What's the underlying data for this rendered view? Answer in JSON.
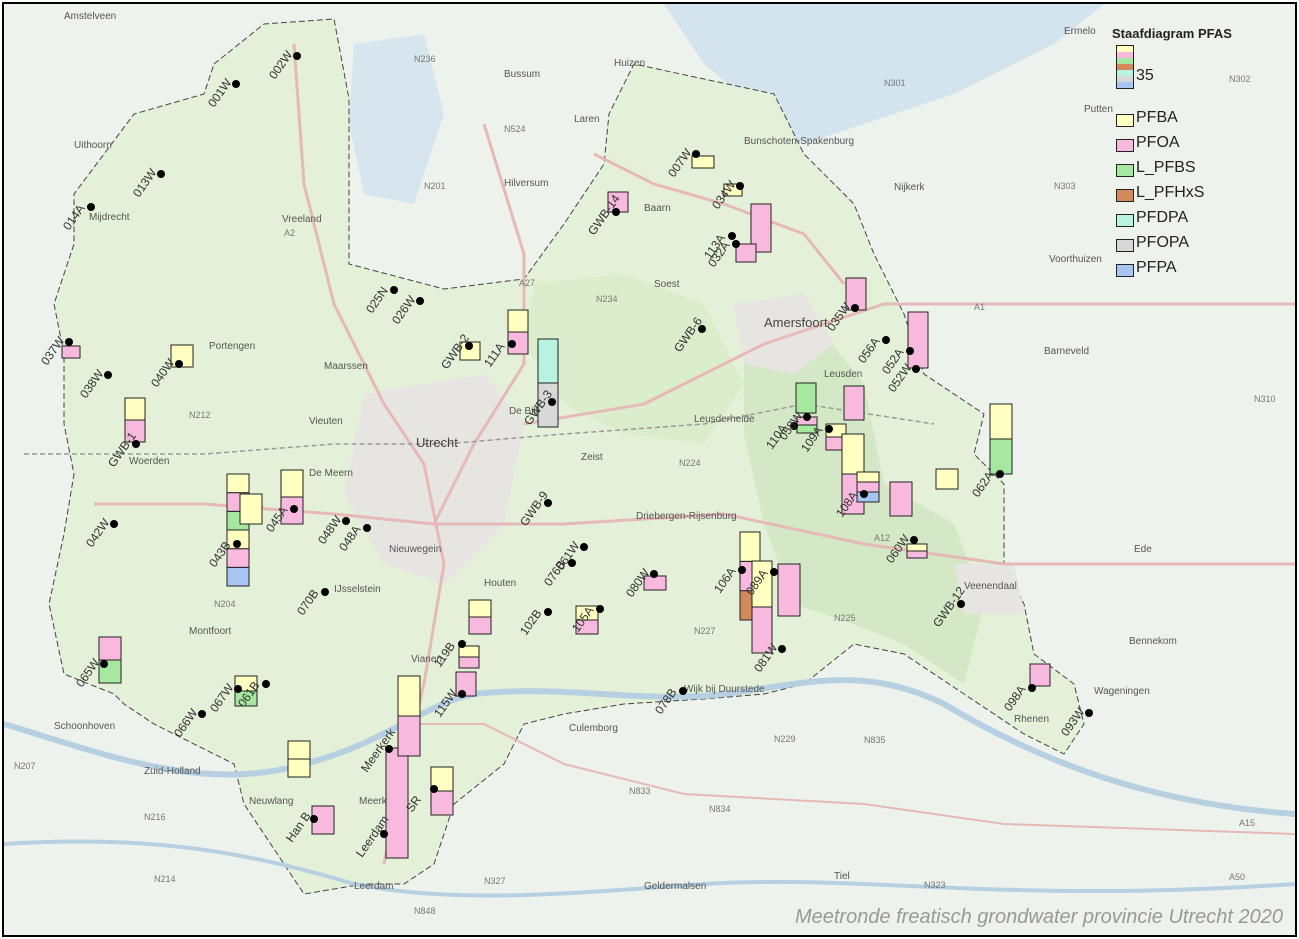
{
  "title": "Meetronde freatisch grondwater provincie Utrecht 2020",
  "legend": {
    "title": "Staafdiagram PFAS",
    "scale_value": "35",
    "items": [
      {
        "label": "PFBA",
        "color": "#ffffc0"
      },
      {
        "label": "PFOA",
        "color": "#f7b9dd"
      },
      {
        "label": "L_PFBS",
        "color": "#a6e8a0"
      },
      {
        "label": "L_PFHxS",
        "color": "#d28a5a"
      },
      {
        "label": "PFDPA",
        "color": "#b8f2e0"
      },
      {
        "label": "PFOPA",
        "color": "#d8d8d8"
      },
      {
        "label": "PFPA",
        "color": "#a8c4f2"
      }
    ]
  },
  "places": [
    "Amstelveen",
    "Huizen",
    "Bussum",
    "Laren",
    "Hilversum",
    "Baarn",
    "Bunschoten-Spakenburg",
    "Soest",
    "Amersfoort",
    "Leusden",
    "Nijkerk",
    "Putten",
    "Ermelo",
    "Barneveld",
    "Voorthuizen",
    "Uithoorn",
    "Mijdrecht",
    "Vreeland",
    "Portengen",
    "Maarssen",
    "Vieuten",
    "Woerden",
    "De Meern",
    "Utrecht",
    "Zeist",
    "De Bilt",
    "Nieuwegein",
    "IJsselstein",
    "Houten",
    "Driebergen-Rijsenburg",
    "Montfoort",
    "Vianen",
    "Culemborg",
    "Schoonhoven",
    "Neuwlang",
    "Meerkerk",
    "Leerdam",
    "Wijk bij Duurstede",
    "Veenendaal",
    "Ede",
    "Bennekom",
    "Wageningen",
    "Tiel",
    "Geldermalsen",
    "Rhenen",
    "Leusderheide",
    "Zuid-Holland"
  ],
  "roads": [
    "N236",
    "N524",
    "N201",
    "A2",
    "A27",
    "N234",
    "N301",
    "N302",
    "N303",
    "A1",
    "N310",
    "N212",
    "N224",
    "A12",
    "N204",
    "N227",
    "N225",
    "N229",
    "N835",
    "N833",
    "N834",
    "N216",
    "N214",
    "N207",
    "N327",
    "N848",
    "N323",
    "A15",
    "A50"
  ],
  "locations": [
    {
      "id": "001W"
    },
    {
      "id": "002W"
    },
    {
      "id": "013W"
    },
    {
      "id": "014A"
    },
    {
      "id": "025N"
    },
    {
      "id": "026W"
    },
    {
      "id": "037W"
    },
    {
      "id": "038W"
    },
    {
      "id": "040W"
    },
    {
      "id": "GWB-1"
    },
    {
      "id": "042W"
    },
    {
      "id": "043B"
    },
    {
      "id": "045A"
    },
    {
      "id": "048W"
    },
    {
      "id": "048A"
    },
    {
      "id": "070B"
    },
    {
      "id": "GWB-2"
    },
    {
      "id": "111A"
    },
    {
      "id": "GWB-3"
    },
    {
      "id": "GWB-6"
    },
    {
      "id": "GWB-9"
    },
    {
      "id": "GWB-14"
    },
    {
      "id": "007W"
    },
    {
      "id": "034W"
    },
    {
      "id": "113A"
    },
    {
      "id": "032A"
    },
    {
      "id": "035W"
    },
    {
      "id": "056A"
    },
    {
      "id": "052A"
    },
    {
      "id": "052W"
    },
    {
      "id": "110A"
    },
    {
      "id": "058W"
    },
    {
      "id": "109A"
    },
    {
      "id": "108A"
    },
    {
      "id": "062A"
    },
    {
      "id": "060W"
    },
    {
      "id": "GWB-12"
    },
    {
      "id": "098A"
    },
    {
      "id": "093W"
    },
    {
      "id": "106A"
    },
    {
      "id": "089A"
    },
    {
      "id": "081W"
    },
    {
      "id": "078B"
    },
    {
      "id": "080W"
    },
    {
      "id": "105A"
    },
    {
      "id": "102B"
    },
    {
      "id": "076B"
    },
    {
      "id": "061W"
    },
    {
      "id": "119B"
    },
    {
      "id": "115W"
    },
    {
      "id": "065W"
    },
    {
      "id": "066W"
    },
    {
      "id": "067W"
    },
    {
      "id": "061B"
    },
    {
      "id": "Han B"
    },
    {
      "id": "SR"
    },
    {
      "id": "Meerkerk"
    },
    {
      "id": "Leerdam"
    }
  ],
  "bars": [
    {
      "stack": [
        "PFOA"
      ]
    },
    {
      "stack": [
        "PFBA"
      ]
    },
    {
      "stack": [
        "PFOA",
        "PFBA"
      ]
    },
    {
      "stack": [
        "PFPA",
        "PFOA",
        "PFBA",
        "L_PFBS",
        "PFOA",
        "PFBA"
      ]
    },
    {
      "stack": [
        "PFOA",
        "PFBA"
      ]
    },
    {
      "stack": [
        "PFBA"
      ]
    },
    {
      "stack": [
        "PFOA",
        "PFBA"
      ]
    },
    {
      "stack": [
        "PFOPA",
        "PFDPA"
      ]
    },
    {
      "stack": [
        "PFOA"
      ]
    },
    {
      "stack": [
        "PFBA"
      ]
    },
    {
      "stack": [
        "PFBA"
      ]
    },
    {
      "stack": [
        "L_PFBS",
        "PFOA"
      ]
    },
    {
      "stack": [
        "PFOA"
      ]
    },
    {
      "stack": [
        "PFOA"
      ]
    },
    {
      "stack": [
        "PFOA"
      ]
    },
    {
      "stack": [
        "PFOA"
      ]
    },
    {
      "stack": [
        "L_PFBS"
      ]
    },
    {
      "stack": [
        "PFOA"
      ]
    },
    {
      "stack": [
        "PFOA",
        "PFBA"
      ]
    },
    {
      "stack": [
        "PFOA",
        "PFBA"
      ]
    },
    {
      "stack": [
        "L_PFBS",
        "PFBA"
      ]
    },
    {
      "stack": [
        "PFOA",
        "PFBA"
      ]
    },
    {
      "stack": [
        "PFOA"
      ]
    },
    {
      "stack": [
        "L_PFHxS",
        "PFOA",
        "PFBA"
      ]
    },
    {
      "stack": [
        "PFOA"
      ]
    },
    {
      "stack": [
        "PFOA"
      ]
    },
    {
      "stack": [
        "PFOA",
        "PFBA"
      ]
    },
    {
      "stack": [
        "PFOA",
        "PFBA"
      ]
    },
    {
      "stack": [
        "PFOA",
        "PFBA"
      ]
    },
    {
      "stack": [
        "PFOA"
      ]
    },
    {
      "stack": [
        "L_PFBS",
        "PFOA"
      ]
    },
    {
      "stack": [
        "L_PFBS",
        "PFBA"
      ]
    },
    {
      "stack": [
        "PFBA",
        "PFBA"
      ]
    },
    {
      "stack": [
        "PFOA"
      ]
    },
    {
      "stack": [
        "PFOA",
        "PFBA"
      ]
    },
    {
      "stack": [
        "PFOA"
      ]
    },
    {
      "stack": [
        "PFOA",
        "PFBA"
      ]
    },
    {
      "stack": [
        "PFBA"
      ]
    },
    {
      "stack": [
        "PFOA",
        "PFBA"
      ]
    },
    {
      "stack": [
        "PFPA",
        "PFOA",
        "PFBA"
      ]
    },
    {
      "stack": [
        "PFOA"
      ]
    },
    {
      "stack": [
        "PFBA"
      ]
    }
  ]
}
